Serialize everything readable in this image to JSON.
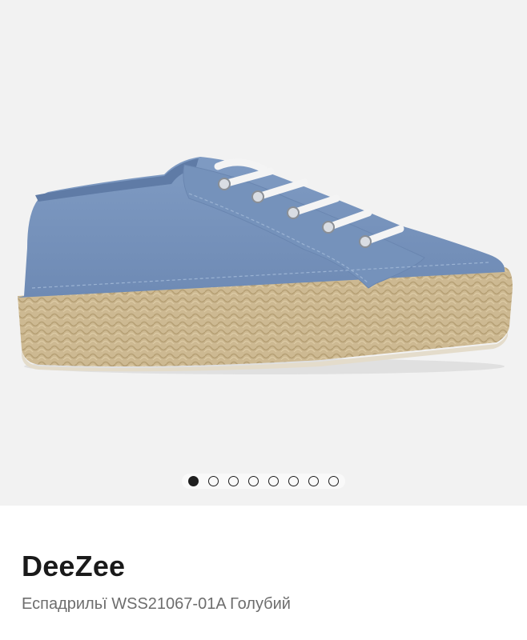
{
  "gallery": {
    "image_alt": "Blue canvas espadrille sneaker with white laces and jute platform sole",
    "slide_count": 8,
    "active_slide": 1
  },
  "product": {
    "brand": "DeeZee",
    "description": "Еспадрильї WSS21067-01A Голубий"
  },
  "colors": {
    "background": "#f2f2f2",
    "upper": "#7c98c0",
    "jute": "#cdb992",
    "laces": "#f4f4f4",
    "text_primary": "#1a1a1a",
    "text_secondary": "#6d6d6d"
  }
}
